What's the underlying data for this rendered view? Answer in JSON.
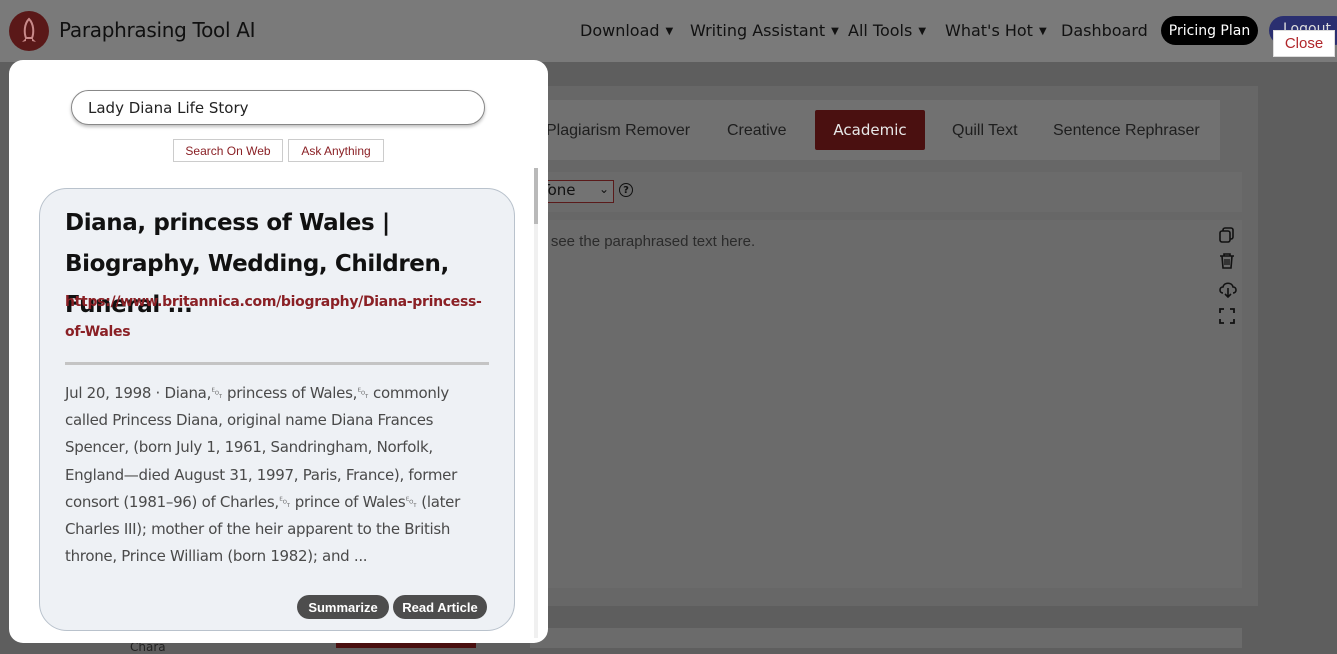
{
  "header": {
    "brand": "Paraphrasing Tool AI",
    "nav": [
      {
        "label": "Download",
        "caret": "▼"
      },
      {
        "label": "Writing Assistant",
        "caret": "▼"
      },
      {
        "label": "All Tools",
        "caret": "▼"
      },
      {
        "label": "What's Hot",
        "caret": "▼"
      },
      {
        "label": "Dashboard"
      }
    ],
    "pricing_label": "Pricing Plan",
    "logout_label": "Logout",
    "close_label": "Close"
  },
  "modes": {
    "items": [
      "Plagiarism Remover",
      "Creative",
      "Academic",
      "Quill Text",
      "Sentence Rephraser"
    ],
    "active": "Academic"
  },
  "tone": {
    "selected": "Tone",
    "help": "?"
  },
  "output": {
    "placeholder": "ll see the paraphrased text here."
  },
  "side_icons": [
    "copy-icon",
    "trash-icon",
    "download-cloud-icon",
    "fullscreen-icon"
  ],
  "bottom": {
    "text": "Chara"
  },
  "modal": {
    "search_value": "Lady Diana Life Story",
    "search_web_label": "Search On Web",
    "ask_anything_label": "Ask Anything",
    "result": {
      "title": "Diana, princess of Wales | Biography, Wedding, Children, Funeral ...",
      "url": "https://www.britannica.com/biography/Diana-princess-of-Wales",
      "snippet": "Jul 20, 1998 · Diana,␄ princess of Wales,␄ commonly called Princess Diana, original name Diana Frances Spencer, (born July 1, 1961, Sandringham, Norfolk, England—died August 31, 1997, Paris, France), former consort (1981–96) of Charles,␄ prince of Wales␄ (later Charles III); mother of the heir apparent to the British throne, Prince William (born 1982); and ...",
      "summarize_label": "Summarize",
      "read_article_label": "Read Article"
    }
  },
  "colors": {
    "brand_red": "#8a2025",
    "active_mode": "#7a1c1c",
    "overlay": "#5e5e5e"
  }
}
